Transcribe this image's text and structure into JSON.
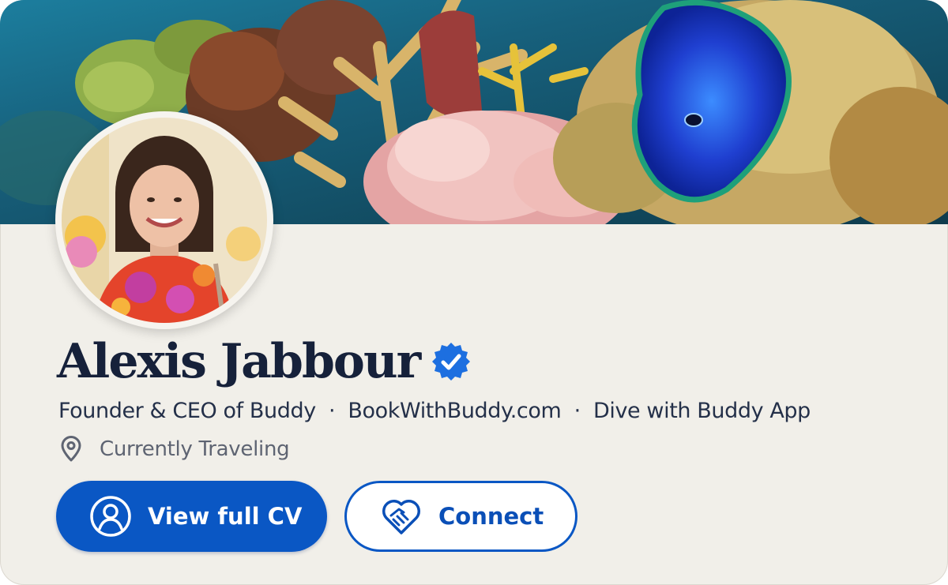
{
  "profile": {
    "name": "Alexis Jabbour",
    "verified_icon": "verified-badge-icon",
    "headline": {
      "role": "Founder & CEO of Buddy",
      "separator": "·",
      "website": "BookWithBuddy.com",
      "app": "Dive with Buddy App"
    },
    "location": "Currently Traveling",
    "location_icon": "location-pin-icon"
  },
  "actions": {
    "view_cv_label": "View full CV",
    "view_cv_icon": "user-circle-icon",
    "connect_label": "Connect",
    "connect_icon": "handshake-heart-icon"
  },
  "colors": {
    "primary": "#0a57c4",
    "name": "#16213a",
    "card_background": "#f1efe9",
    "verified": "#1d6fe0"
  }
}
